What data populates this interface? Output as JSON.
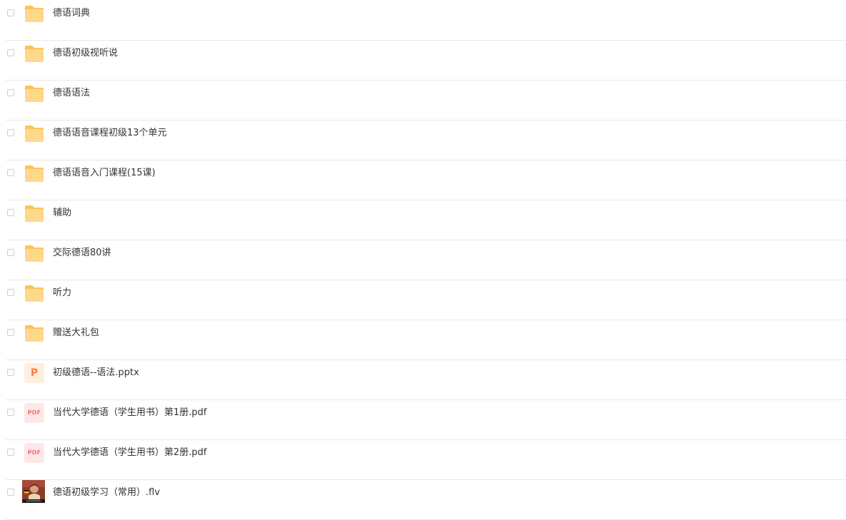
{
  "files": [
    {
      "name": "德语词典",
      "type": "folder",
      "icon": "folder-icon"
    },
    {
      "name": "德语初级视听说",
      "type": "folder",
      "icon": "folder-icon"
    },
    {
      "name": "德语语法",
      "type": "folder",
      "icon": "folder-icon"
    },
    {
      "name": "德语语音课程初级13个单元",
      "type": "folder",
      "icon": "folder-icon"
    },
    {
      "name": "德语语音入门课程(15课)",
      "type": "folder",
      "icon": "folder-icon"
    },
    {
      "name": "辅助",
      "type": "folder",
      "icon": "folder-icon"
    },
    {
      "name": "交际德语80讲",
      "type": "folder",
      "icon": "folder-icon"
    },
    {
      "name": "听力",
      "type": "folder",
      "icon": "folder-icon"
    },
    {
      "name": "赠送大礼包",
      "type": "folder",
      "icon": "folder-icon"
    },
    {
      "name": "初级德语--语法.pptx",
      "type": "pptx",
      "icon": "ppt-file-icon",
      "badge": "P"
    },
    {
      "name": "当代大学德语（学生用书）第1册.pdf",
      "type": "pdf",
      "icon": "pdf-file-icon",
      "badge": "PDF"
    },
    {
      "name": "当代大学德语（学生用书）第2册.pdf",
      "type": "pdf",
      "icon": "pdf-file-icon",
      "badge": "PDF"
    },
    {
      "name": "德语初级学习（常用）.flv",
      "type": "video",
      "icon": "video-thumbnail"
    }
  ],
  "colors": {
    "folder": "#fbc35a",
    "folder_front": "#ffd98a",
    "pdf_bg": "#fde8e8",
    "pdf_text": "#f0707a",
    "ppt_bg": "#ffeede",
    "ppt_text": "#f5823c",
    "divider": "#e8e8e8",
    "text": "#333333"
  }
}
